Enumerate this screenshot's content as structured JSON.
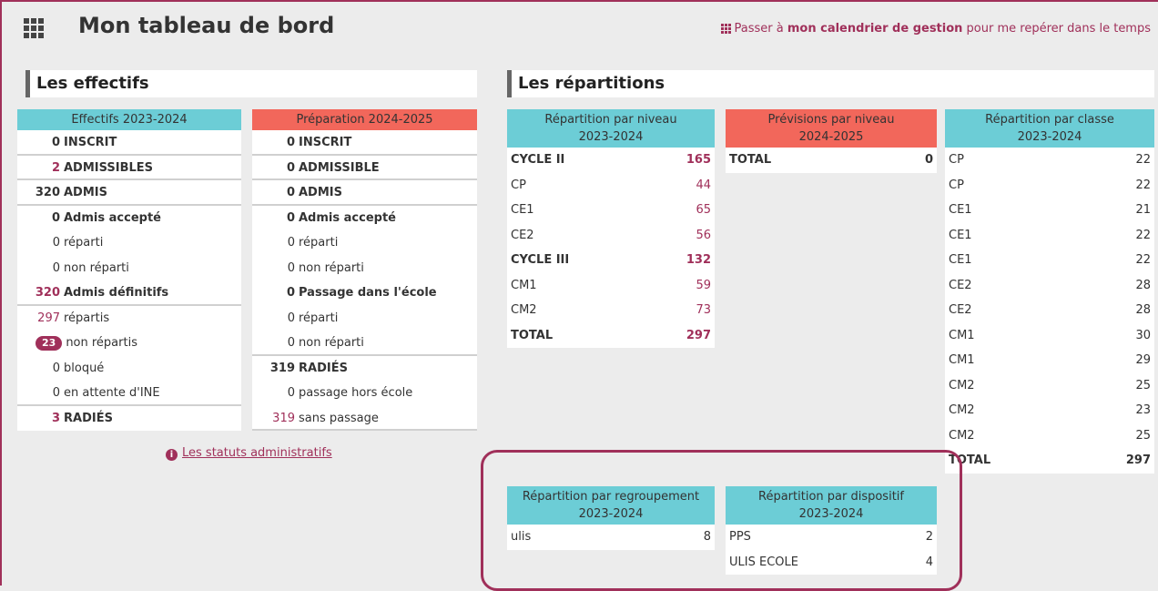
{
  "header": {
    "title": "Mon tableau de bord",
    "link_prefix": "Passer à ",
    "link_bold": "mon calendrier de gestion",
    "link_suffix": " pour me repérer dans le temps"
  },
  "effectifs": {
    "title": "Les effectifs",
    "current": {
      "header": "Effectifs 2023-2024",
      "rows": [
        {
          "num": "0",
          "label": "INSCRIT",
          "bold": true
        },
        {
          "num": "2",
          "label": "ADMISSIBLES",
          "bold": true,
          "pink": true
        },
        {
          "num": "320",
          "label": "ADMIS",
          "bold": true
        },
        {
          "num": "0",
          "label": "Admis accepté",
          "bold": true
        },
        {
          "num": "0",
          "label": "réparti"
        },
        {
          "num": "0",
          "label": "non réparti"
        },
        {
          "num": "320",
          "label": "Admis définitifs",
          "bold": true,
          "pink": true
        },
        {
          "num": "297",
          "label": "répartis",
          "pink": true
        },
        {
          "num": "23",
          "label": "non répartis",
          "badge": true
        },
        {
          "num": "0",
          "label": "bloqué"
        },
        {
          "num": "0",
          "label": "en attente d'INE"
        },
        {
          "num": "3",
          "label": "RADIÉS",
          "bold": true,
          "pink": true
        }
      ]
    },
    "prep": {
      "header": "Préparation 2024-2025",
      "rows": [
        {
          "num": "0",
          "label": "INSCRIT",
          "bold": true
        },
        {
          "num": "0",
          "label": "ADMISSIBLE",
          "bold": true
        },
        {
          "num": "0",
          "label": "ADMIS",
          "bold": true
        },
        {
          "num": "0",
          "label": "Admis accepté",
          "bold": true
        },
        {
          "num": "0",
          "label": "réparti"
        },
        {
          "num": "0",
          "label": "non réparti"
        },
        {
          "num": "0",
          "label": "Passage dans l'école",
          "bold": true
        },
        {
          "num": "0",
          "label": "réparti"
        },
        {
          "num": "0",
          "label": "non réparti"
        },
        {
          "num": "319",
          "label": "RADIÉS",
          "bold": true
        },
        {
          "num": "0",
          "label": "passage hors école"
        },
        {
          "num": "319",
          "label": "sans passage",
          "pink": true
        }
      ]
    },
    "info_link": "Les statuts administratifs"
  },
  "repartitions": {
    "title": "Les répartitions",
    "par_niveau": {
      "header_line1": "Répartition par niveau",
      "header_line2": "2023-2024",
      "rows": [
        {
          "label": "CYCLE II",
          "value": "165",
          "bold": true
        },
        {
          "label": "CP",
          "value": "44"
        },
        {
          "label": "CE1",
          "value": "65"
        },
        {
          "label": "CE2",
          "value": "56"
        },
        {
          "label": "CYCLE III",
          "value": "132",
          "bold": true
        },
        {
          "label": "CM1",
          "value": "59"
        },
        {
          "label": "CM2",
          "value": "73"
        },
        {
          "label": "TOTAL",
          "value": "297",
          "bold": true
        }
      ]
    },
    "previsions": {
      "header_line1": "Prévisions par niveau",
      "header_line2": "2024-2025",
      "rows": [
        {
          "label": "TOTAL",
          "value": "0",
          "bold": true
        }
      ]
    },
    "par_classe": {
      "header_line1": "Répartition par classe",
      "header_line2": "2023-2024",
      "rows": [
        {
          "label": "CP",
          "value": "22"
        },
        {
          "label": "CP",
          "value": "22"
        },
        {
          "label": "CE1",
          "value": "21"
        },
        {
          "label": "CE1",
          "value": "22"
        },
        {
          "label": "CE1",
          "value": "22"
        },
        {
          "label": "CE2",
          "value": "28"
        },
        {
          "label": "CE2",
          "value": "28"
        },
        {
          "label": "CM1",
          "value": "30"
        },
        {
          "label": "CM1",
          "value": "29"
        },
        {
          "label": "CM2",
          "value": "25"
        },
        {
          "label": "CM2",
          "value": "23"
        },
        {
          "label": "CM2",
          "value": "25"
        },
        {
          "label": "TOTAL",
          "value": "297",
          "bold": true
        }
      ]
    },
    "par_regroupement": {
      "header_line1": "Répartition par regroupement",
      "header_line2": "2023-2024",
      "rows": [
        {
          "label": "ulis",
          "value": "8"
        }
      ]
    },
    "par_dispositif": {
      "header_line1": "Répartition par dispositif",
      "header_line2": "2023-2024",
      "rows": [
        {
          "label": "PPS",
          "value": "2"
        },
        {
          "label": "ULIS ECOLE",
          "value": "4"
        }
      ]
    }
  }
}
